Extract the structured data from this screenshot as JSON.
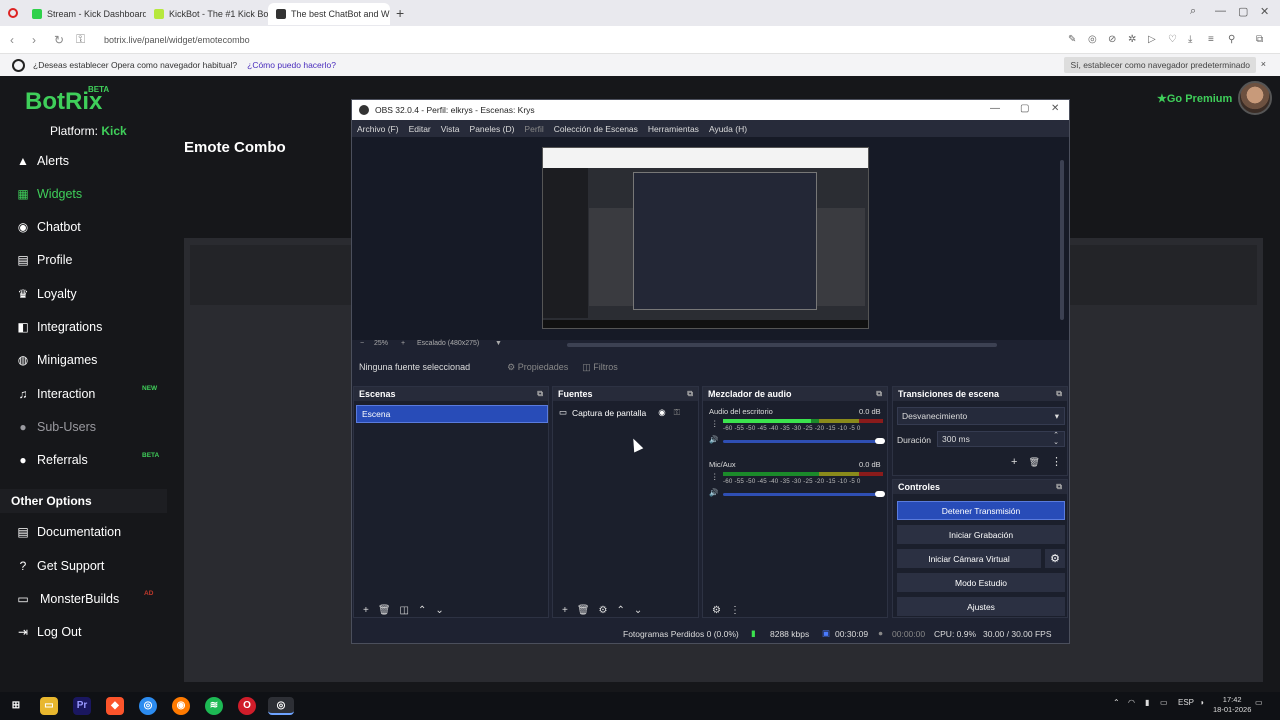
{
  "browser": {
    "tabs": [
      {
        "label": "Stream - Kick Dashboard",
        "color": "#2ed14a"
      },
      {
        "label": "KickBot - The #1 Kick Bot",
        "color": "#b7e83d"
      },
      {
        "label": "The best ChatBot and Wi",
        "color": "#333333"
      }
    ],
    "new_tab": "+",
    "url": "botrix.live/panel/widget/emotecombo",
    "infobar_text": "¿Deseas establecer Opera como navegador habitual?",
    "infobar_link": "¿Cómo puedo hacerlo?",
    "infobar_button": "Sí, establecer como navegador predeterminado",
    "infobar_close": "×"
  },
  "site": {
    "logo": "BotRix",
    "logo_badge": "BETA",
    "platform_label": "Platform:",
    "platform_value": "Kick",
    "page_title": "Emote Combo",
    "premium": "Go Premium",
    "nav": [
      {
        "label": "Alerts",
        "icon": "bell-icon",
        "glyph": "▲"
      },
      {
        "label": "Widgets",
        "icon": "widgets-icon",
        "glyph": "▦"
      },
      {
        "label": "Chatbot",
        "icon": "robot-icon",
        "glyph": "◉"
      },
      {
        "label": "Profile",
        "icon": "profile-icon",
        "glyph": "▤"
      },
      {
        "label": "Loyalty",
        "icon": "trophy-icon",
        "glyph": "♛"
      },
      {
        "label": "Integrations",
        "icon": "integrations-icon",
        "glyph": "◧"
      },
      {
        "label": "Minigames",
        "icon": "gamepad-icon",
        "glyph": "◍"
      },
      {
        "label": "Interaction",
        "icon": "music-icon",
        "glyph": "♫",
        "badge": "NEW"
      },
      {
        "label": "Sub-Users",
        "icon": "users-icon",
        "glyph": "●"
      },
      {
        "label": "Referrals",
        "icon": "referrals-icon",
        "glyph": "●",
        "badge": "BETA"
      }
    ],
    "other_options": "Other Options",
    "other_nav": [
      {
        "label": "Documentation",
        "icon": "book-icon",
        "glyph": "▤"
      },
      {
        "label": "Get Support",
        "icon": "support-icon",
        "glyph": "?"
      },
      {
        "label": "MonsterBuilds",
        "icon": "laptop-icon",
        "glyph": "▭",
        "badge": "AD"
      },
      {
        "label": "Log Out",
        "icon": "logout-icon",
        "glyph": "⇥"
      }
    ]
  },
  "obs": {
    "title": "OBS 32.0.4 - Perfil: elkrys - Escenas: Krys",
    "menu": [
      "Archivo (F)",
      "Editar",
      "Vista",
      "Paneles (D)",
      "Perfil",
      "Colección de Escenas",
      "Herramientas",
      "Ayuda (H)"
    ],
    "zoom": "25%",
    "scale": "Escalado (480x275)",
    "no_source": "Ninguna fuente seleccionad",
    "properties": "Propiedades",
    "filters": "Filtros",
    "docks": {
      "scenes": "Escenas",
      "sources": "Fuentes",
      "mixer": "Mezclador de audio",
      "transitions": "Transiciones de escena",
      "controls": "Controles"
    },
    "scene_item": "Escena",
    "source_item": "Captura de pantalla",
    "mixer_tracks": [
      {
        "name": "Audio del escritorio",
        "db": "0.0 dB",
        "level": 0.55
      },
      {
        "name": "Mic/Aux",
        "db": "0.0 dB",
        "level": 0.0
      }
    ],
    "meter_ticks": "-60 -55 -50 -45 -40 -35 -30 -25 -20 -15 -10 -5 0",
    "transition": "Desvanecimiento",
    "duration_label": "Duración",
    "duration_value": "300 ms",
    "controls": [
      "Detener Transmisión",
      "Iniciar Grabación",
      "Iniciar Cámara Virtual",
      "Modo Estudio",
      "Ajustes"
    ],
    "status": {
      "dropped": "Fotogramas Perdidos 0 (0.0%)",
      "bitrate": "8288 kbps",
      "stream_time": "00:30:09",
      "rec_time": "00:00:00",
      "cpu": "CPU: 0.9%",
      "fps": "30.00 / 30.00 FPS"
    }
  },
  "taskbar": {
    "lang": "ESP",
    "time": "17:42",
    "date": "18-01-2026"
  }
}
